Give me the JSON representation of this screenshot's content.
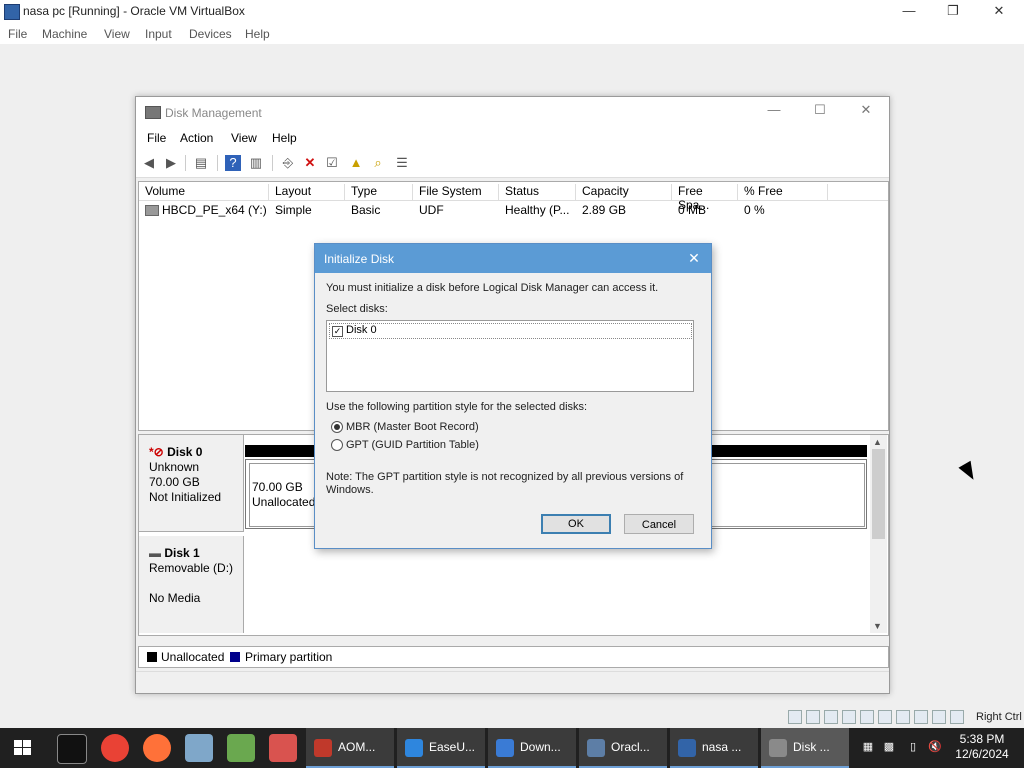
{
  "vbox": {
    "title": "nasa pc [Running] - Oracle VM VirtualBox",
    "menu": [
      "File",
      "Machine",
      "View",
      "Input",
      "Devices",
      "Help"
    ],
    "controls": {
      "minimize": "—",
      "restore": "❐",
      "close": "✕"
    }
  },
  "disk_mgmt": {
    "title": "Disk Management",
    "menu": [
      "File",
      "Action",
      "View",
      "Help"
    ],
    "controls": {
      "minimize": "—",
      "maximize": "☐",
      "close": "✕"
    },
    "columns": [
      "Volume",
      "Layout",
      "Type",
      "File System",
      "Status",
      "Capacity",
      "Free Spa...",
      "% Free"
    ],
    "volumes": [
      {
        "volume": "HBCD_PE_x64 (Y:)",
        "layout": "Simple",
        "type": "Basic",
        "fs": "UDF",
        "status": "Healthy (P...",
        "capacity": "2.89 GB",
        "free": "0 MB",
        "pct_free": "0 %"
      }
    ],
    "disks": [
      {
        "name": "Disk 0",
        "type": "Unknown",
        "size": "70.00 GB",
        "state": "Not Initialized",
        "partition_size": "70.00 GB",
        "partition_state": "Unallocated"
      },
      {
        "name": "Disk 1",
        "type": "Removable (D:)",
        "state": "No Media"
      }
    ],
    "legend": [
      {
        "label": "Unallocated",
        "color": "#000000"
      },
      {
        "label": "Primary partition",
        "color": "#00008b"
      }
    ]
  },
  "dialog": {
    "title": "Initialize Disk",
    "message": "You must initialize a disk before Logical Disk Manager can access it.",
    "select_label": "Select disks:",
    "disks": [
      {
        "label": "Disk 0",
        "checked": true
      }
    ],
    "style_label": "Use the following partition style for the selected disks:",
    "options": [
      {
        "label": "MBR (Master Boot Record)",
        "selected": true
      },
      {
        "label": "GPT (GUID Partition Table)",
        "selected": false
      }
    ],
    "note": "Note: The GPT partition style is not recognized by all previous versions of Windows.",
    "ok": "OK",
    "cancel": "Cancel"
  },
  "vbox_status": {
    "host_key": "Right Ctrl"
  },
  "taskbar": {
    "buttons": [
      {
        "label": "AOM...",
        "icon_color": "#c0392b"
      },
      {
        "label": "EaseU...",
        "icon_color": "#2e86de"
      },
      {
        "label": "Down...",
        "icon_color": "#3a7bd5"
      },
      {
        "label": "Oracl...",
        "icon_color": "#5d7ea6"
      },
      {
        "label": "nasa ...",
        "icon_color": "#3264a8"
      },
      {
        "label": "Disk ...",
        "icon_color": "#8a8a8a"
      }
    ],
    "clock": {
      "time": "5:38 PM",
      "date": "12/6/2024"
    }
  }
}
